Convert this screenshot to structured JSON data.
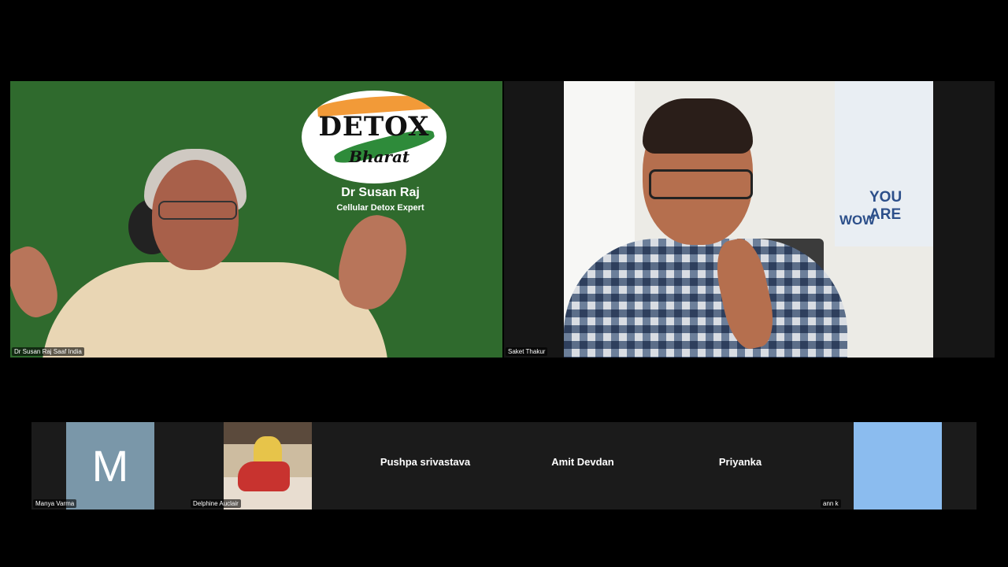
{
  "main_tiles": {
    "susan": {
      "name_tag": "Dr Susan Raj Saaf India",
      "logo_line1": "DETOX",
      "logo_line2": "Bharat",
      "speaker_name": "Dr Susan Raj",
      "speaker_title": "Cellular Detox Expert"
    },
    "saket": {
      "name_tag": "Saket Thakur",
      "poster_text1": "YOU ARE",
      "poster_text2": "WOW"
    }
  },
  "gallery": {
    "participants": [
      {
        "name": "Manya Varma",
        "avatar_letter": "M"
      },
      {
        "name": "Delphine Auclair"
      },
      {
        "name": "Pushpa srivastava"
      },
      {
        "name": "Amit Devdan"
      },
      {
        "name": "Priyanka"
      },
      {
        "name": "ann k"
      }
    ]
  },
  "colors": {
    "background": "#000000",
    "green_screen": "#2f6a2d",
    "avatar_m": "#7a97a9",
    "sky_tile": "#8bbcef"
  }
}
